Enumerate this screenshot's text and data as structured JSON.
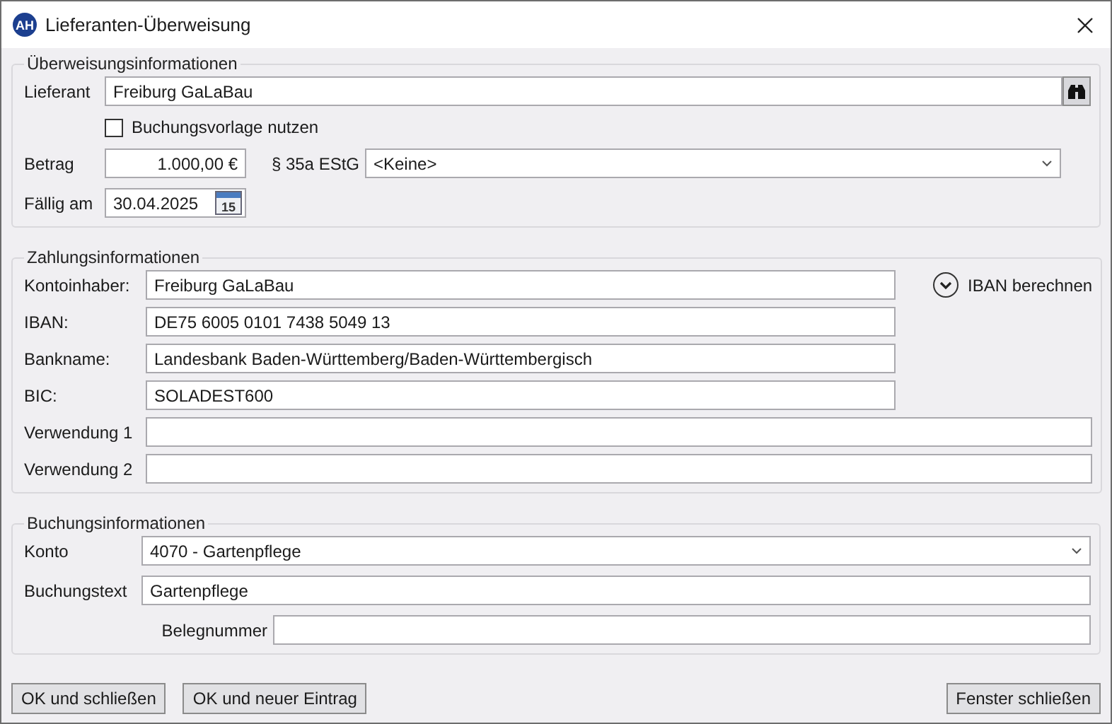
{
  "window": {
    "title": "Lieferanten-Überweisung",
    "badge": "AH"
  },
  "transfer": {
    "legend": "Überweisungsinformationen",
    "supplier": {
      "label": "Lieferant",
      "value": "Freiburg GaLaBau"
    },
    "template": {
      "label": "Buchungsvorlage nutzen",
      "checked": false
    },
    "amount": {
      "label": "Betrag",
      "value": "1.000,00 €"
    },
    "tax": {
      "label": "§ 35a EStG",
      "value": "<Keine>"
    },
    "due": {
      "label": "Fällig am",
      "value": "30.04.2025",
      "calendar_day": "15"
    }
  },
  "payment": {
    "legend": "Zahlungsinformationen",
    "iban_button": "IBAN berechnen",
    "fields": [
      {
        "label": "Kontoinhaber:",
        "value": "Freiburg GaLaBau",
        "kind": "short"
      },
      {
        "label": "IBAN:",
        "value": "DE75 6005 0101 7438 5049 13",
        "kind": "short"
      },
      {
        "label": "Bankname:",
        "value": "Landesbank Baden-Württemberg/Baden-Württembergisch",
        "kind": "short"
      },
      {
        "label": "BIC:",
        "value": "SOLADEST600",
        "kind": "short"
      },
      {
        "label": "Verwendung 1",
        "kind": "long"
      },
      {
        "label": "Verwendung 2",
        "kind": "long"
      }
    ]
  },
  "booking": {
    "legend": "Buchungsinformationen",
    "account": {
      "label": "Konto",
      "value": "4070 - Gartenpflege"
    },
    "text": {
      "label": "Buchungstext",
      "value": "Gartenpflege"
    },
    "receipt": {
      "label": "Belegnummer"
    }
  },
  "buttons": [
    {
      "label": "OK und schließen",
      "kind": "confirm"
    },
    {
      "label": "OK und neuer Eintrag",
      "kind": "confirm"
    },
    {
      "label": "Fenster schließen",
      "kind": "dismiss"
    }
  ]
}
